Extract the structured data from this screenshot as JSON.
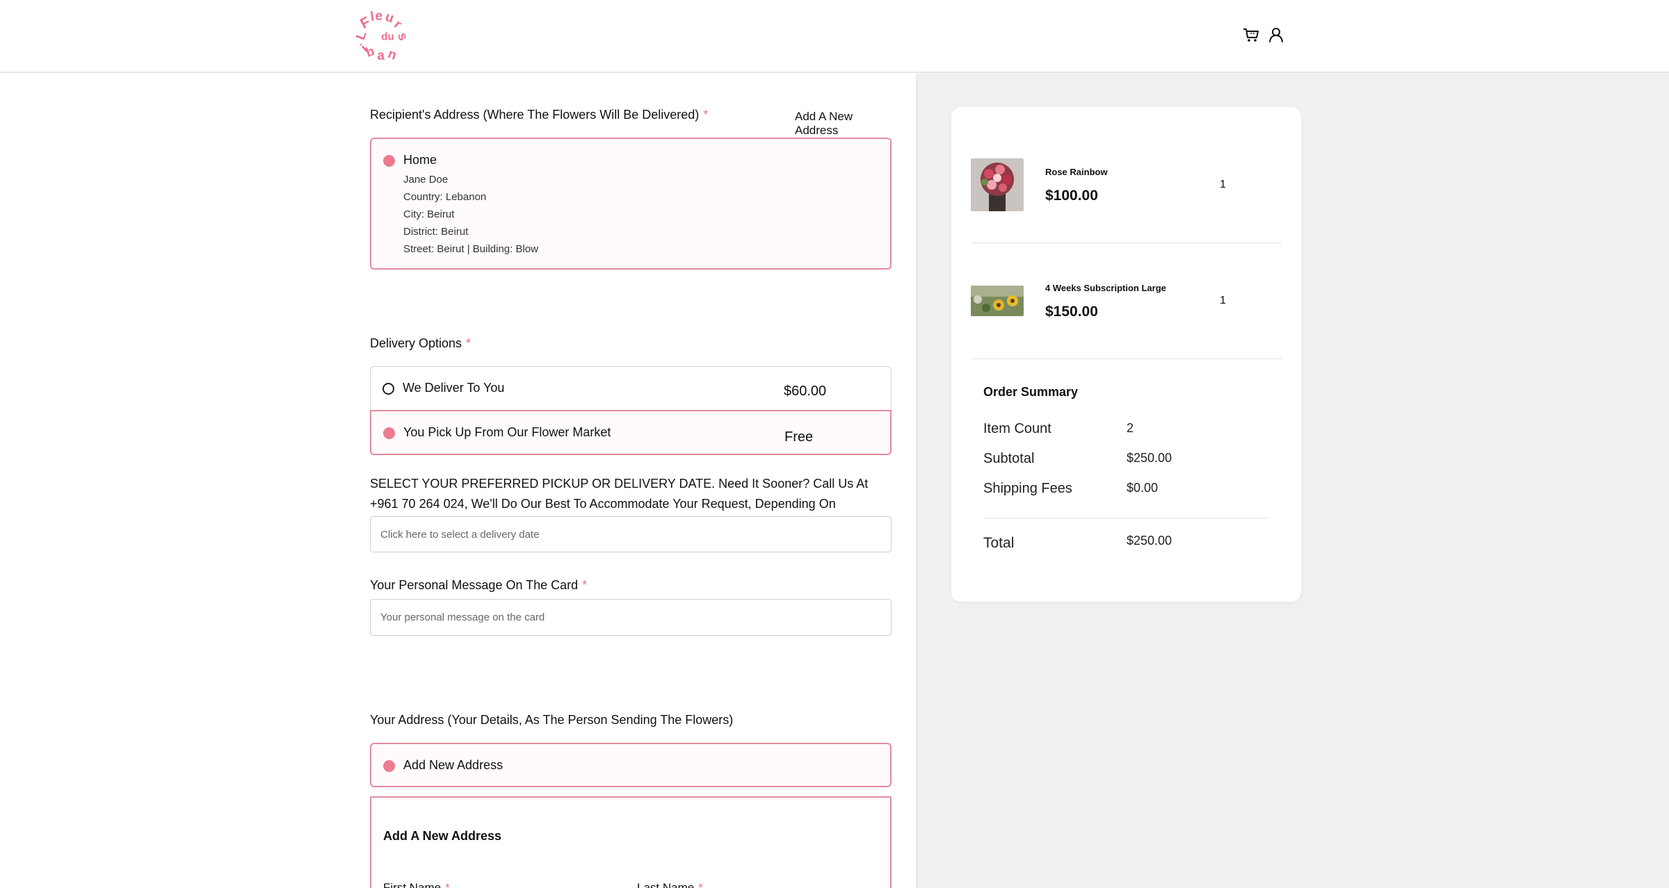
{
  "header": {
    "logo_text": "Fleurs du Liban",
    "icons": [
      "cart-icon",
      "user-icon"
    ]
  },
  "recipient": {
    "label": "Recipient's Address (Where The Flowers Will Be Delivered)",
    "required": "*",
    "add_link": "Add A New Address",
    "address": {
      "title": "Home",
      "name": "Jane Doe",
      "country": "Country: Lebanon",
      "city": "City: Beirut",
      "district": "District: Beirut",
      "street": "Street: Beirut | Building: Blow"
    }
  },
  "delivery": {
    "label": "Delivery Options",
    "required": "*",
    "options": [
      {
        "label": "We Deliver To You",
        "price": "$60.00",
        "selected": false
      },
      {
        "label": "You Pick Up From Our Flower Market",
        "price": "Free",
        "selected": true
      }
    ]
  },
  "date": {
    "label": "SELECT YOUR PREFERRED PICKUP OR DELIVERY DATE. Need It Sooner? Call Us At +961 70 264 024, We'll Do Our Best To Accommodate Your Request, Depending On Availability.",
    "required": "*",
    "placeholder": "Click here to select a delivery date"
  },
  "message": {
    "label": "Your Personal Message On The Card",
    "required": "*",
    "placeholder": "Your personal message on the card"
  },
  "sender": {
    "label": "Your Address (Your Details, As The Person Sending The Flowers)",
    "option": "Add New Address",
    "form_title": "Add A New Address",
    "first_name": "First Name",
    "last_name": "Last Name",
    "required": "*"
  },
  "cart": {
    "items": [
      {
        "name": "Rose Rainbow",
        "price": "$100.00",
        "qty": "1"
      },
      {
        "name": "4 Weeks Subscription Large",
        "price": "$150.00",
        "qty": "1"
      }
    ]
  },
  "summary": {
    "title": "Order Summary",
    "item_count_label": "Item Count",
    "item_count": "2",
    "subtotal_label": "Subtotal",
    "subtotal": "$250.00",
    "shipping_label": "Shipping Fees",
    "shipping": "$0.00",
    "total_label": "Total",
    "total": "$250.00"
  },
  "colors": {
    "accent": "#ec7b92",
    "border_accent": "#e48b9d",
    "panel_bg": "#f0f0f0"
  }
}
